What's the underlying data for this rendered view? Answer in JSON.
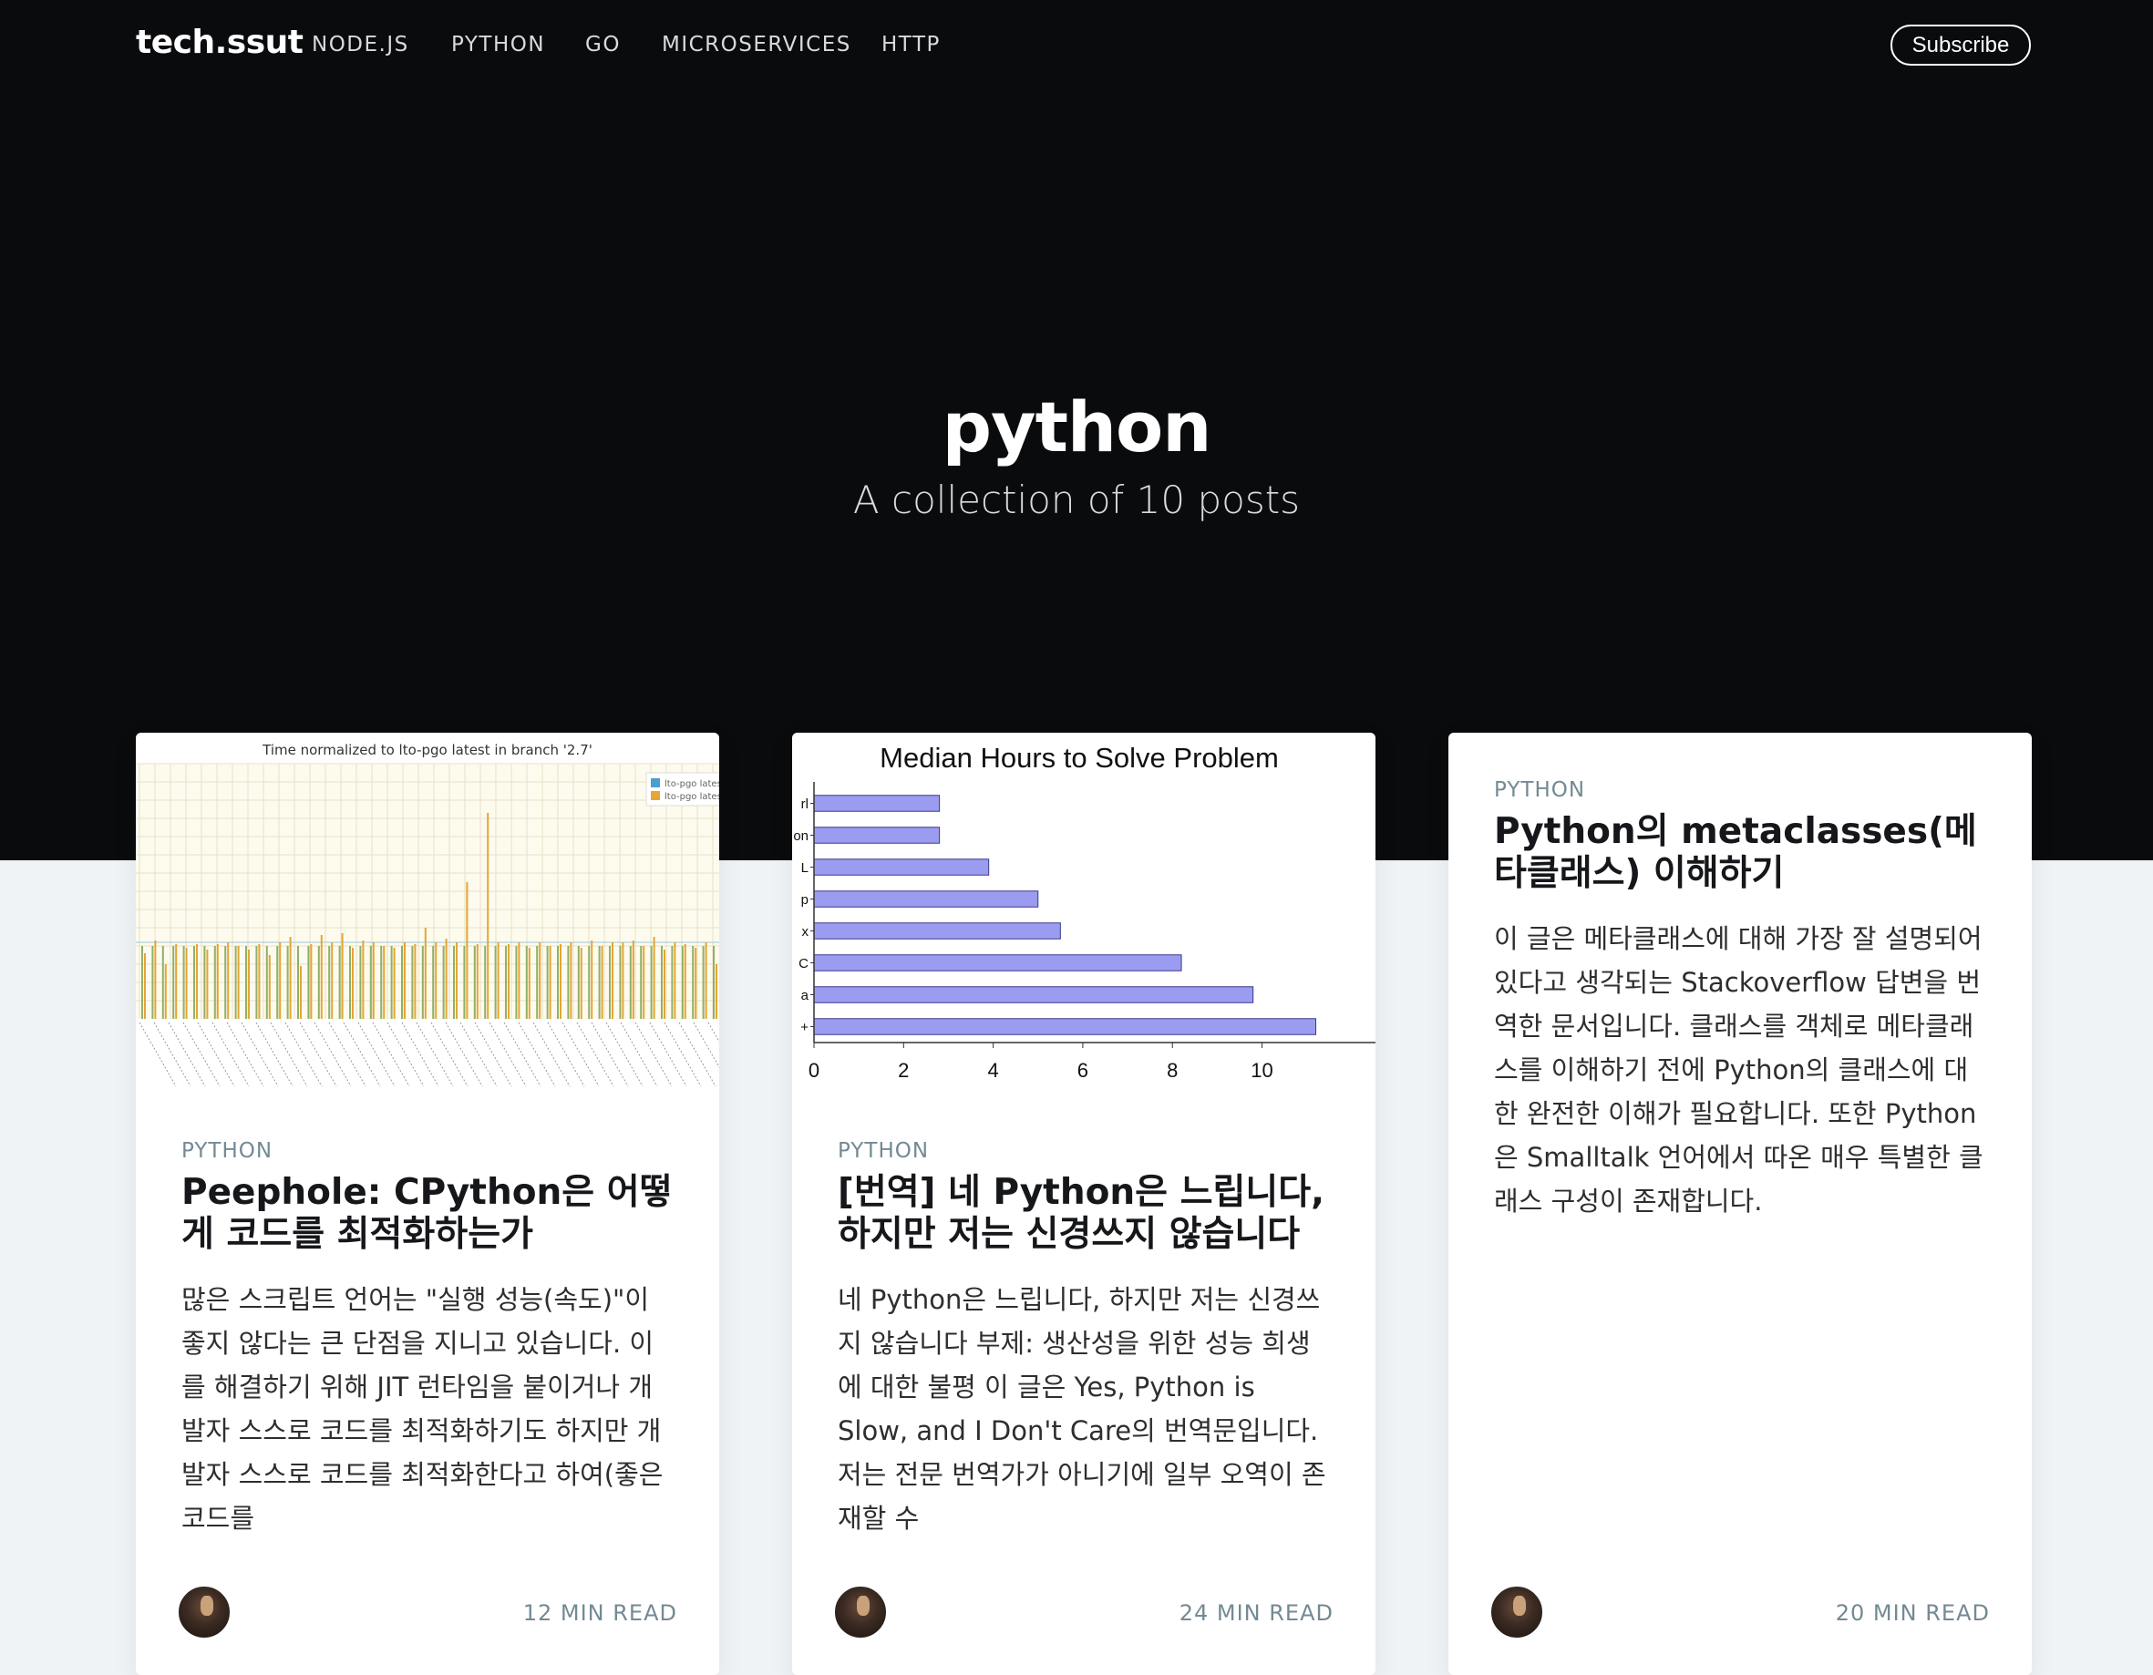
{
  "site": {
    "logo": "tech.ssut",
    "nav": [
      "NODE.JS",
      "PYTHON",
      "GO",
      "MICROSERVICES",
      "HTTP"
    ],
    "subscribe_label": "Subscribe"
  },
  "tag": {
    "title": "python",
    "description": "A collection of 10 posts"
  },
  "posts": [
    {
      "tag": "PYTHON",
      "title": "Peephole: CPython은 어떻게 코드를 최적화하는가",
      "excerpt": "많은 스크립트 언어는 \"실행 성능(속도)\"이 좋지 않다는 큰 단점을 지니고 있습니다. 이를 해결하기 위해 JIT 런타임을 붙이거나 개발자 스스로 코드를 최적화하기도 하지만 개발자 스스로 코드를 최적화한다고 하여(좋은 코드를",
      "read_time": "12 MIN READ",
      "image": {
        "title": "Time normalized to lto-pgo latest in branch '2.7'",
        "legend": [
          "lto-pgo latest",
          "lto-pgo latest"
        ]
      }
    },
    {
      "tag": "PYTHON",
      "title": "[번역] 네 Python은 느립니다, 하지만 저는 신경쓰지 않습니다",
      "excerpt": "네 Python은 느립니다, 하지만 저는 신경쓰지 않습니다 부제: 생산성을 위한 성능 희생에 대한 불평 이 글은 Yes, Python is Slow, and I Don't Care의 번역문입니다. 저는 전문 번역가가 아니기에 일부 오역이 존재할 수",
      "read_time": "24 MIN READ",
      "image": {
        "chart_data": {
          "type": "bar",
          "orientation": "horizontal",
          "title": "Median Hours to Solve Problem",
          "categories": [
            "rl",
            "on",
            "L",
            "p",
            "x",
            "C",
            "a",
            "+"
          ],
          "values": [
            2.8,
            2.8,
            3.9,
            5.0,
            5.5,
            8.2,
            9.8,
            11.2
          ],
          "xticks": [
            0,
            2,
            4,
            6,
            8,
            10
          ],
          "xlim": [
            0,
            11.8
          ],
          "color": "#9b9bf0"
        }
      }
    },
    {
      "tag": "PYTHON",
      "title": "Python의 metaclasses(메타클래스) 이해하기",
      "excerpt": "이 글은 메타클래스에 대해 가장 잘 설명되어 있다고 생각되는 Stackoverflow 답변을 번역한 문서입니다. 클래스를 객체로 메타클래스를 이해하기 전에 Python의 클래스에 대한 완전한 이해가 필요합니다. 또한 Python은 Smalltalk 언어에서 따온 매우 특별한 클래스 구성이 존재합니다.",
      "read_time": "20 MIN READ"
    }
  ],
  "colors": {
    "hero_bg": "#0a0b0d",
    "page_bg": "#f0f3f6",
    "tag_color": "#738a94"
  }
}
